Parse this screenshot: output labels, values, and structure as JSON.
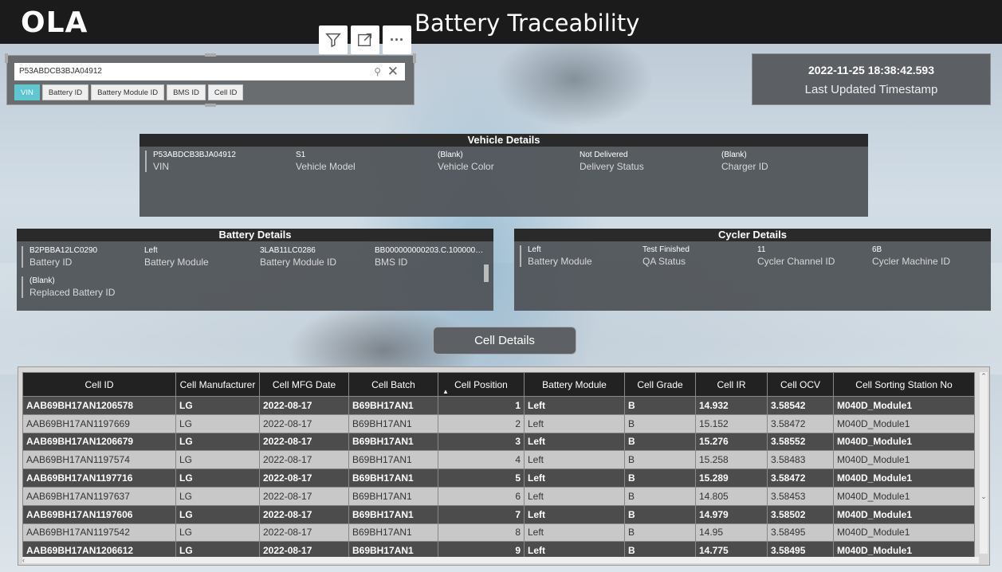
{
  "header": {
    "logo": "OLA",
    "title": "Battery Traceability"
  },
  "toolbar": {
    "icons": [
      "filter-icon",
      "focus-mode-icon",
      "more-options-icon"
    ],
    "more_label": "···"
  },
  "slicer": {
    "search_value": "P53ABDCB3BJA04912",
    "chips": [
      {
        "label": "VIN",
        "active": true
      },
      {
        "label": "Battery ID",
        "active": false
      },
      {
        "label": "Battery Module ID",
        "active": false
      },
      {
        "label": "BMS ID",
        "active": false
      },
      {
        "label": "Cell ID",
        "active": false
      }
    ]
  },
  "timestamp": {
    "value": "2022-11-25 18:38:42.593",
    "label": "Last Updated Timestamp"
  },
  "vehicle_details": {
    "title": "Vehicle Details",
    "fields": [
      {
        "value": "P53ABDCB3BJA04912",
        "label": "VIN"
      },
      {
        "value": "S1",
        "label": "Vehicle Model"
      },
      {
        "value": "(Blank)",
        "label": "Vehicle Color"
      },
      {
        "value": "Not Delivered",
        "label": "Delivery Status"
      },
      {
        "value": "(Blank)",
        "label": "Charger ID"
      }
    ]
  },
  "battery_details": {
    "title": "Battery Details",
    "fields": [
      {
        "value": "B2PBBA12LC0290",
        "label": "Battery ID"
      },
      {
        "value": "Left",
        "label": "Battery Module"
      },
      {
        "value": "3LAB11LC0286",
        "label": "Battery Module ID"
      },
      {
        "value": "BB000000000203.C.1000000...",
        "label": "BMS ID"
      },
      {
        "value": "(Blank)",
        "label": "Replaced Battery ID"
      }
    ]
  },
  "cycler_details": {
    "title": "Cycler Details",
    "fields": [
      {
        "value": "Left",
        "label": "Battery Module"
      },
      {
        "value": "Test Finished",
        "label": "QA Status"
      },
      {
        "value": "11",
        "label": "Cycler Channel ID"
      },
      {
        "value": "6B",
        "label": "Cycler Machine ID"
      }
    ]
  },
  "cell_details_button": "Cell Details",
  "cell_table": {
    "columns": [
      "Cell ID",
      "Cell Manufacturer",
      "Cell MFG Date",
      "Cell Batch",
      "Cell Position",
      "Battery Module",
      "Cell Grade",
      "Cell IR",
      "Cell OCV",
      "Cell Sorting Station No"
    ],
    "sorted_column": "Cell Position",
    "rows": [
      [
        "AAB69BH17AN1206578",
        "LG",
        "2022-08-17",
        "B69BH17AN1",
        "1",
        "Left",
        "B",
        "14.932",
        "3.58542",
        "M040D_Module1"
      ],
      [
        "AAB69BH17AN1197669",
        "LG",
        "2022-08-17",
        "B69BH17AN1",
        "2",
        "Left",
        "B",
        "15.152",
        "3.58472",
        "M040D_Module1"
      ],
      [
        "AAB69BH17AN1206679",
        "LG",
        "2022-08-17",
        "B69BH17AN1",
        "3",
        "Left",
        "B",
        "15.276",
        "3.58552",
        "M040D_Module1"
      ],
      [
        "AAB69BH17AN1197574",
        "LG",
        "2022-08-17",
        "B69BH17AN1",
        "4",
        "Left",
        "B",
        "15.258",
        "3.58483",
        "M040D_Module1"
      ],
      [
        "AAB69BH17AN1197716",
        "LG",
        "2022-08-17",
        "B69BH17AN1",
        "5",
        "Left",
        "B",
        "15.289",
        "3.58472",
        "M040D_Module1"
      ],
      [
        "AAB69BH17AN1197637",
        "LG",
        "2022-08-17",
        "B69BH17AN1",
        "6",
        "Left",
        "B",
        "14.805",
        "3.58453",
        "M040D_Module1"
      ],
      [
        "AAB69BH17AN1197606",
        "LG",
        "2022-08-17",
        "B69BH17AN1",
        "7",
        "Left",
        "B",
        "14.979",
        "3.58502",
        "M040D_Module1"
      ],
      [
        "AAB69BH17AN1197542",
        "LG",
        "2022-08-17",
        "B69BH17AN1",
        "8",
        "Left",
        "B",
        "14.95",
        "3.58495",
        "M040D_Module1"
      ],
      [
        "AAB69BH17AN1206612",
        "LG",
        "2022-08-17",
        "B69BH17AN1",
        "9",
        "Left",
        "B",
        "14.775",
        "3.58495",
        "M040D_Module1"
      ]
    ]
  },
  "colors": {
    "header_bg": "#1b1b1b",
    "accent_chip": "#5fc7d2",
    "panel_bg": "#4e5256",
    "row_dark": "#4c4c4c",
    "row_light": "#c8c8c8"
  }
}
